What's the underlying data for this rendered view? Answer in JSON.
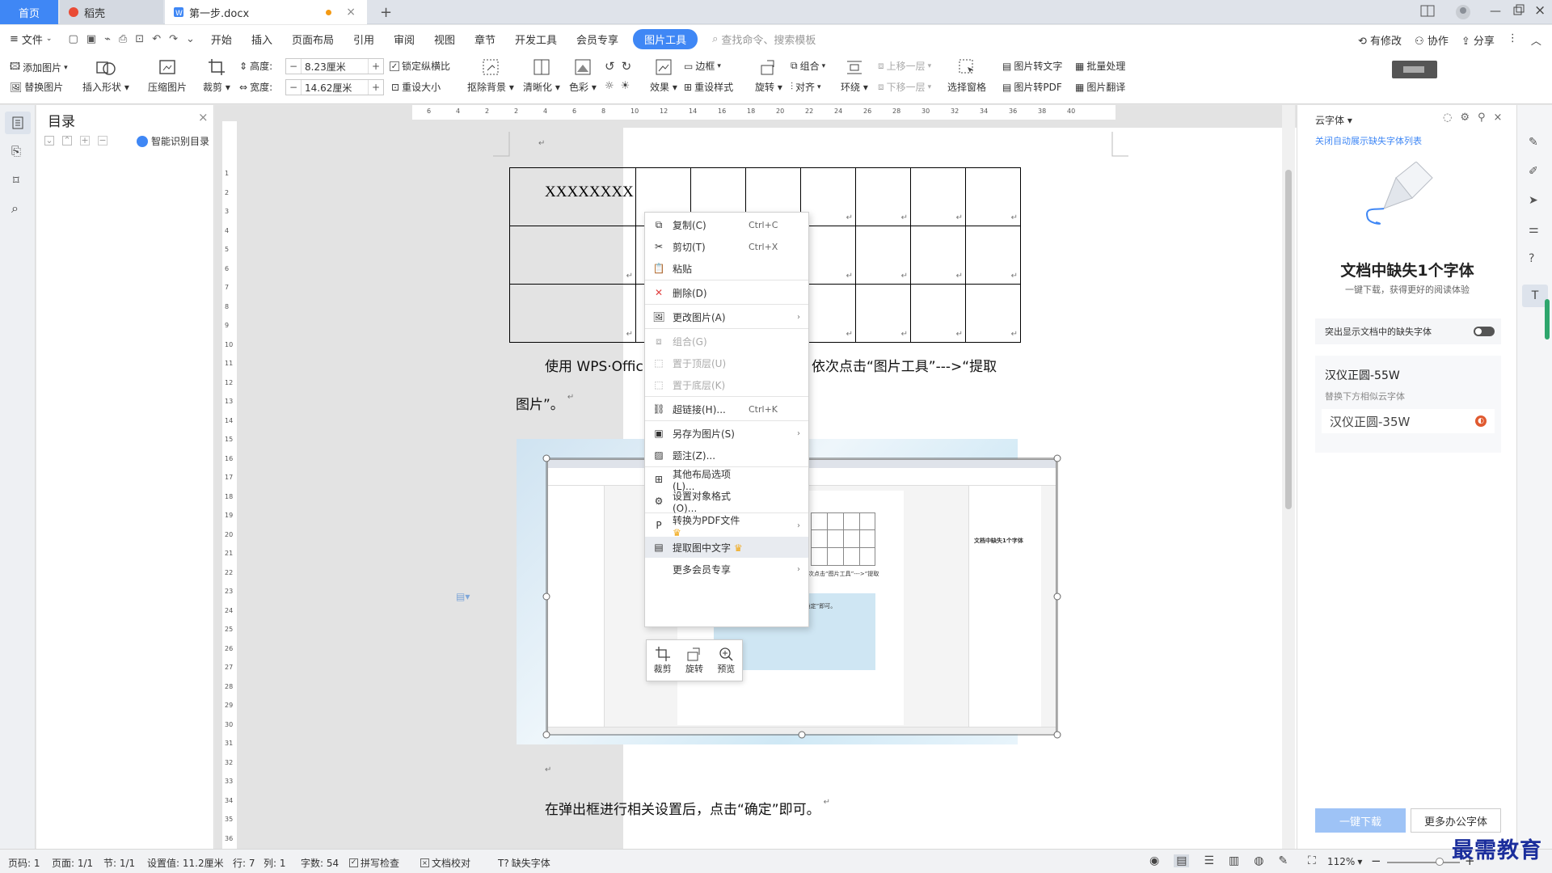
{
  "tabs": {
    "home": "首页",
    "daoke": "稻壳",
    "doc": "第一步.docx",
    "new": "+"
  },
  "menu": {
    "file": "文件",
    "items": [
      "开始",
      "插入",
      "页面布局",
      "引用",
      "审阅",
      "视图",
      "章节",
      "开发工具",
      "会员专享"
    ],
    "active": "图片工具",
    "search": "查找命令、搜索模板",
    "right": [
      "有修改",
      "协作",
      "分享"
    ]
  },
  "ribbon": {
    "add_pic": "添加图片",
    "replace_pic": "替换图片",
    "insert_shape": "插入形状",
    "compress": "压缩图片",
    "crop": "裁剪",
    "height_label": "高度:",
    "height_value": "8.23厘米",
    "width_label": "宽度:",
    "width_value": "14.62厘米",
    "lock_ratio": "锁定纵横比",
    "reset_size": "重设大小",
    "remove_bg": "抠除背景",
    "sharpen": "清晰化",
    "color": "色彩",
    "effect": "效果",
    "border": "边框",
    "reset_style": "重设样式",
    "rotate": "旋转",
    "group": "组合",
    "align": "对齐",
    "wrap": "环绕",
    "bring_forward": "上移一层",
    "send_backward": "下移一层",
    "select_pane": "选择窗格",
    "pic_to_text": "图片转文字",
    "batch": "批量处理",
    "pic_to_pdf": "图片转PDF",
    "pic_translate": "图片翻译"
  },
  "toc": {
    "title": "目录",
    "smart": "智能识别目录"
  },
  "ruler_h": [
    "6",
    "4",
    "2",
    "2",
    "4",
    "6",
    "8",
    "10",
    "12",
    "14",
    "16",
    "18",
    "20",
    "22",
    "24",
    "26",
    "28",
    "30",
    "32",
    "34",
    "36",
    "38",
    "40"
  ],
  "ruler_v": [
    "1",
    "2",
    "3",
    "4",
    "5",
    "6",
    "7",
    "8",
    "9",
    "10",
    "11",
    "12",
    "13",
    "14",
    "15",
    "16",
    "17",
    "18",
    "19",
    "20",
    "21",
    "22",
    "23",
    "24",
    "25",
    "26",
    "27",
    "28",
    "29",
    "30",
    "31",
    "32",
    "33",
    "34",
    "35",
    "36"
  ],
  "document": {
    "cell_text": "XXXXXXXX",
    "para_mark": "↵",
    "para1a": "使用 WPS·Offic",
    "para1b": "依次点击“图片工具”--->“提取",
    "para1c": "图片”。",
    "para2": "在弹出框进行相关设置后，点击“确定”即可。",
    "inner_para": "次点击“图片工具”--->“提取",
    "inner_dialog": "在弹出框进行相关设置后，点击“确定”即可。",
    "inner_missing": "文档中缺失1个字体"
  },
  "context_menu": [
    {
      "label": "复制(C)",
      "shortcut": "Ctrl+C",
      "icon": "copy-icon"
    },
    {
      "label": "剪切(T)",
      "shortcut": "Ctrl+X",
      "icon": "scissors-icon"
    },
    {
      "label": "粘贴",
      "shortcut": "",
      "icon": "paste-icon"
    },
    {
      "label": "删除(D)",
      "shortcut": "",
      "icon": "delete-icon"
    },
    {
      "label": "更改图片(A)",
      "shortcut": "",
      "icon": "change-picture-icon",
      "arrow": true
    },
    {
      "label": "组合(G)",
      "shortcut": "",
      "icon": "group-icon",
      "disabled": true
    },
    {
      "label": "置于顶层(U)",
      "shortcut": "",
      "icon": "bring-to-front-icon",
      "disabled": true
    },
    {
      "label": "置于底层(K)",
      "shortcut": "",
      "icon": "send-to-back-icon",
      "disabled": true
    },
    {
      "label": "超链接(H)...",
      "shortcut": "Ctrl+K",
      "icon": "link-icon"
    },
    {
      "label": "另存为图片(S)",
      "shortcut": "",
      "icon": "save-picture-icon",
      "arrow": true
    },
    {
      "label": "题注(Z)...",
      "shortcut": "",
      "icon": "caption-icon"
    },
    {
      "label": "其他布局选项(L)...",
      "shortcut": "",
      "icon": "layout-icon"
    },
    {
      "label": "设置对象格式(O)...",
      "shortcut": "",
      "icon": "format-object-icon"
    },
    {
      "label": "转换为PDF文件",
      "shortcut": "",
      "icon": "pdf-icon",
      "arrow": true,
      "crown": true
    },
    {
      "label": "提取图中文字",
      "shortcut": "",
      "icon": "extract-text-icon",
      "crown": true,
      "highlight": true
    },
    {
      "label": "更多会员专享",
      "shortcut": "",
      "icon": "",
      "arrow": true
    }
  ],
  "mini_toolbar": [
    "裁剪",
    "旋转",
    "预览"
  ],
  "cloud_font": {
    "header": "云字体",
    "close_link": "关闭自动展示缺失字体列表",
    "title": "文档中缺失1个字体",
    "subtitle": "一键下载，获得更好的阅读体验",
    "toggle_label": "突出显示文档中的缺失字体",
    "missing_font": "汉仪正圆-55W",
    "replace_hint": "替换下方相似云字体",
    "similar_font": "汉仪正圆-35W",
    "download_btn": "一键下载",
    "more_btn": "更多办公字体"
  },
  "status": {
    "page": "页码: 1",
    "pages": "页面: 1/1",
    "section": "节: 1/1",
    "setting": "设置值: 11.2厘米",
    "row": "行: 7",
    "col": "列: 1",
    "words": "字数: 54",
    "spell": "拼写检查",
    "proof": "文档校对",
    "missing_font": "缺失字体",
    "zoom": "112%"
  },
  "watermark": "最需教育",
  "colors": {
    "accent": "#3f87f5",
    "toggle": "#555",
    "pdf_red": "#e05a30",
    "crown": "#f1a91a"
  }
}
